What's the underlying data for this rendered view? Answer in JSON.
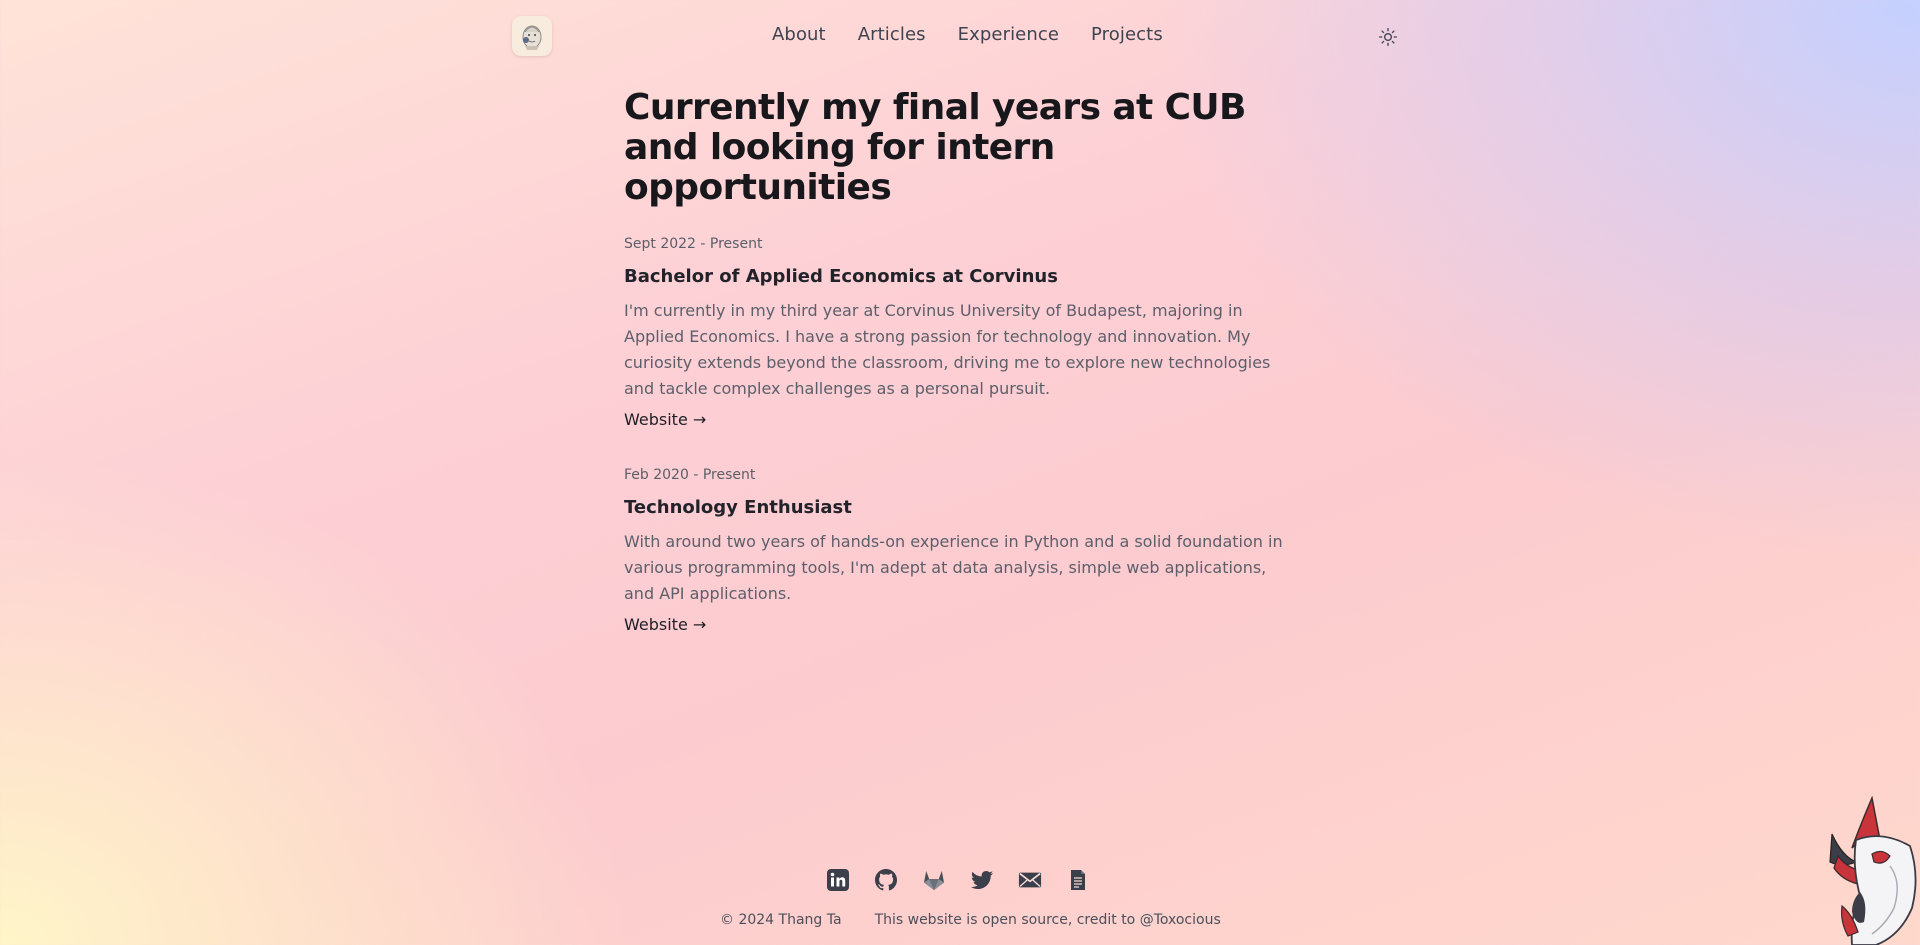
{
  "nav": {
    "items": [
      {
        "label": "About"
      },
      {
        "label": "Articles"
      },
      {
        "label": "Experience"
      },
      {
        "label": "Projects"
      }
    ]
  },
  "icons": {
    "logo": "avatar-logo-icon",
    "theme": "sun-icon",
    "footer": [
      "linkedin-icon",
      "github-icon",
      "gitlab-icon",
      "twitter-icon",
      "mail-icon",
      "resume-document-icon"
    ]
  },
  "main": {
    "title": "Currently my final years at CUB and looking for intern opportunities",
    "entries": [
      {
        "date": "Sept 2022 - Present",
        "title": "Bachelor of Applied Economics at Corvinus",
        "description": "I'm currently in my third year at Corvinus University of Budapest, majoring in Applied Economics. I have a strong passion for technology and innovation. My curiosity extends beyond the classroom, driving me to explore new technologies and tackle complex challenges as a personal pursuit.",
        "link": "Website →"
      },
      {
        "date": "Feb 2020 - Present",
        "title": "Technology Enthusiast",
        "description": "With around two years of hands-on experience in Python and a solid foundation in various programming tools, I'm adept at data analysis, simple web applications, and API applications.",
        "link": "Website →"
      }
    ]
  },
  "footer": {
    "copyright": "© 2024 Thang Ta",
    "credit": "This website is open source, credit to @Toxocious"
  },
  "colors": {
    "accent_text": "#18181c",
    "muted_text": "#5c5f6a",
    "background_pink": "#fccbcf",
    "background_blue": "#c4d0ff",
    "background_yellow": "#fff8c8"
  }
}
